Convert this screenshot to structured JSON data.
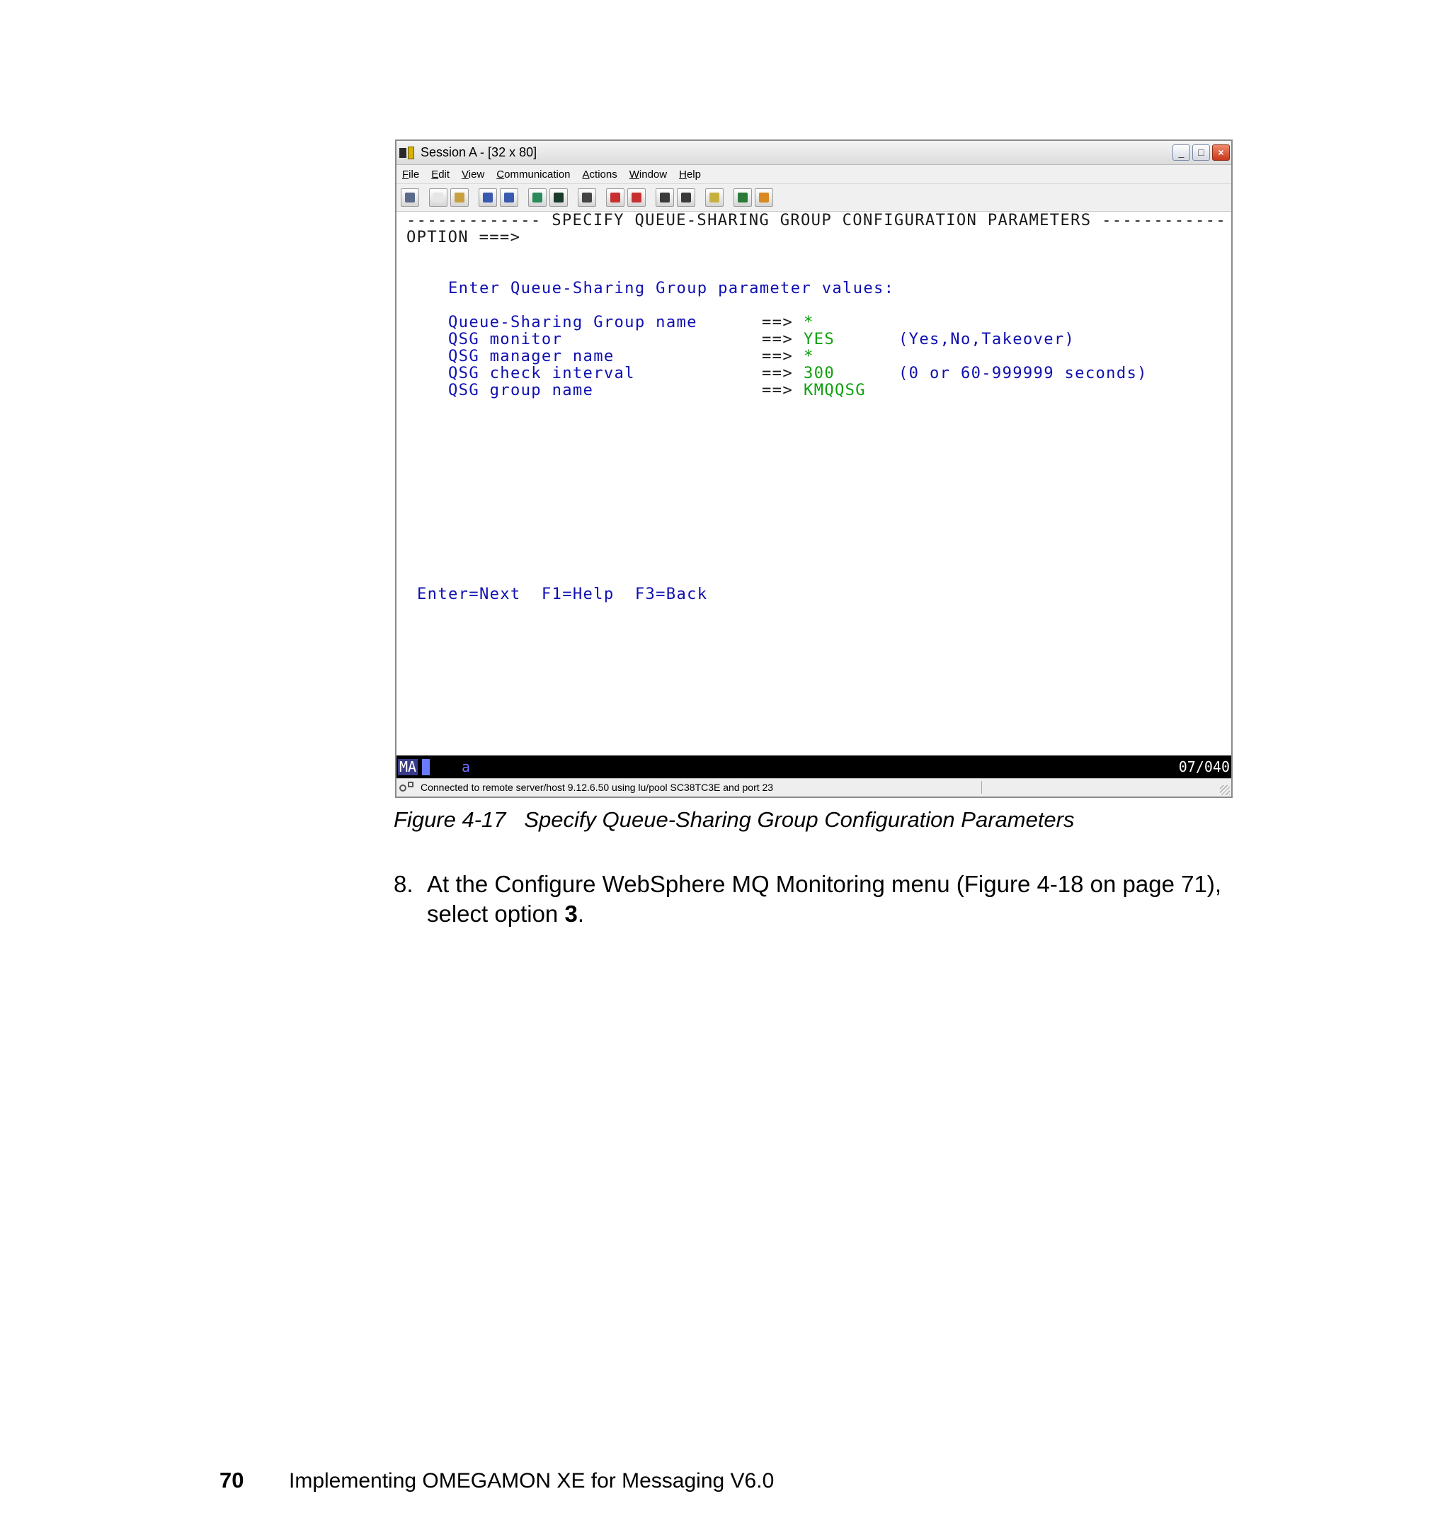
{
  "window": {
    "title": "Session A - [32 x 80]",
    "menu": [
      "File",
      "Edit",
      "View",
      "Communication",
      "Actions",
      "Window",
      "Help"
    ],
    "menu_accel": [
      "F",
      "E",
      "V",
      "C",
      "A",
      "W",
      "H"
    ],
    "controls": {
      "minimize": "_",
      "maximize": "□",
      "close": "×"
    }
  },
  "toolbar": {
    "icons": [
      "print-screen-icon",
      "copy-icon",
      "paste-icon",
      "send-file-icon",
      "receive-file-icon",
      "display-icon",
      "keyboard-map-icon",
      "macro-record-icon",
      "macro-play-icon",
      "macro-stop-icon",
      "macro-edit-icon",
      "macro-run-icon",
      "clipboard-icon",
      "globe-icon",
      "support-icon"
    ]
  },
  "screen": {
    "header": "------------- SPECIFY QUEUE-SHARING GROUP CONFIGURATION PARAMETERS ------------",
    "option": "OPTION ===>",
    "intro": "Enter Queue-Sharing Group parameter values:",
    "fields": [
      {
        "label": "Queue-Sharing Group name",
        "arrow": "==>",
        "value": "*",
        "hint": ""
      },
      {
        "label": "QSG monitor",
        "arrow": "==>",
        "value": "YES",
        "hint": "(Yes,No,Takeover)"
      },
      {
        "label": "QSG manager name",
        "arrow": "==>",
        "value": "*",
        "hint": ""
      },
      {
        "label": "QSG check interval",
        "arrow": "==>",
        "value": "300",
        "hint": "(0 or 60-999999 seconds)"
      },
      {
        "label": "QSG group name",
        "arrow": "==>",
        "value": "KMQQSG",
        "hint": ""
      }
    ],
    "pf_keys": "Enter=Next  F1=Help  F3=Back",
    "colors": {
      "text": "#1010b0",
      "input": "#10a010",
      "header": "#1a1a1a"
    }
  },
  "oia": {
    "mode": "MA",
    "session": "a",
    "cursor_position": "07/040"
  },
  "statusbar": {
    "text": "Connected to remote server/host 9.12.6.50 using lu/pool SC38TC3E and port 23"
  },
  "document": {
    "caption": "Figure 4-17   Specify Queue-Sharing Group Configuration Parameters",
    "step_number": "8.",
    "step_line1": "At the Configure WebSphere MQ Monitoring menu (Figure 4-18 on page 71),",
    "step_line2_prefix": "select option ",
    "step_line2_bold": "3",
    "step_line2_suffix": ".",
    "page_number": "70",
    "book_title": "Implementing OMEGAMON XE for Messaging V6.0"
  }
}
